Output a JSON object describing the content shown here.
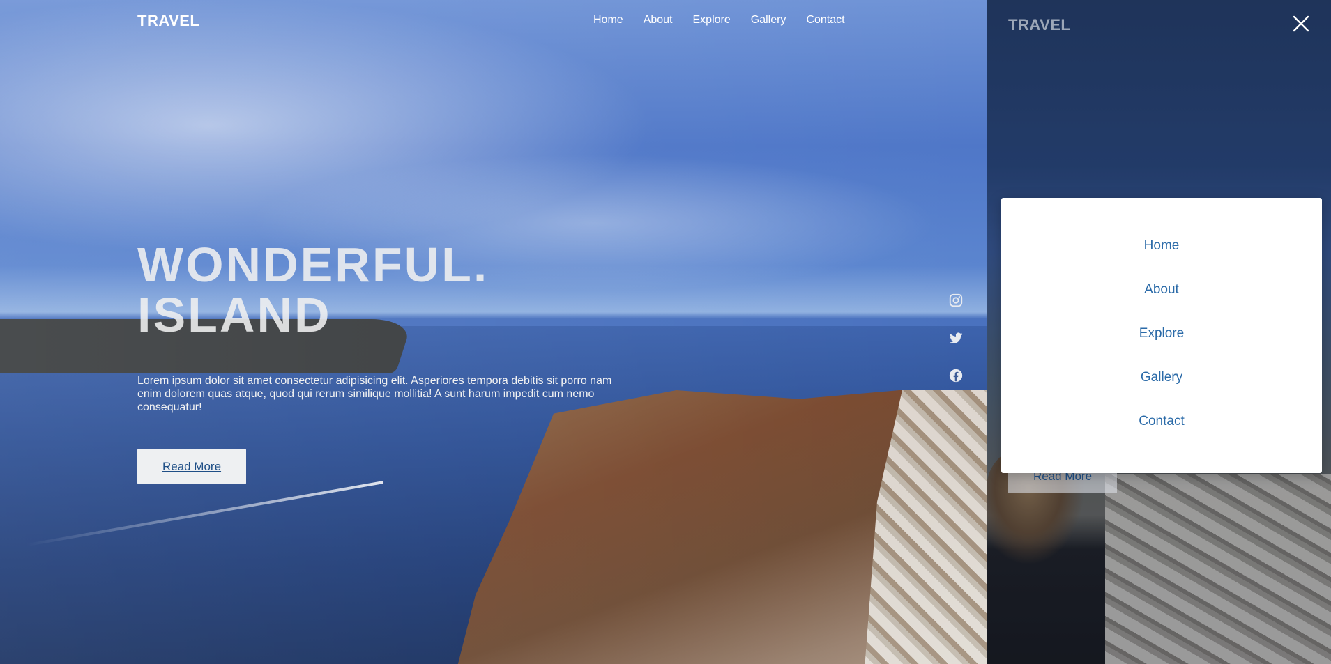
{
  "main": {
    "logo": "TRAVEL",
    "nav": [
      "Home",
      "About",
      "Explore",
      "Gallery",
      "Contact"
    ],
    "headline_line1": "WONDERFUL.",
    "headline_line2": "ISLAND",
    "lead": "Lorem ipsum dolor sit amet consectetur adipisicing elit. Asperiores tempora debitis sit porro nam enim dolorem quas atque, quod qui rerum similique mollitia! A sunt harum impedit cum nemo consequatur!",
    "read_more": "Read More",
    "social": [
      "instagram-icon",
      "twitter-icon",
      "facebook-icon"
    ]
  },
  "panel": {
    "logo": "TRAVEL",
    "read_more": "Read More",
    "close_icon": "close-icon",
    "menu": [
      "Home",
      "About",
      "Explore",
      "Gallery",
      "Contact"
    ]
  },
  "colors": {
    "menu_link": "#2a6aa8",
    "button_text": "#1f4f86",
    "button_bg": "#eef0f2"
  }
}
